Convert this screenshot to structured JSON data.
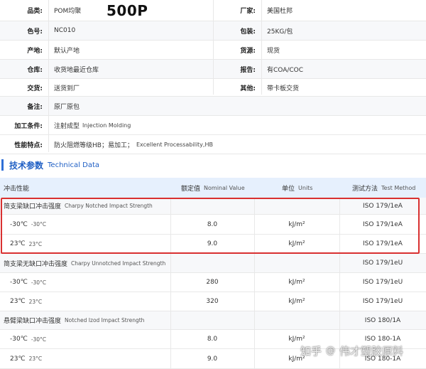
{
  "watermark_badge": "500P",
  "info": {
    "rows": [
      {
        "l1": "品类:",
        "v1": "POM均聚",
        "l2": "厂家:",
        "v2": "美国杜邦"
      },
      {
        "l1": "色号:",
        "v1": "NC010",
        "l2": "包装:",
        "v2": "25KG/包"
      },
      {
        "l1": "产地:",
        "v1": "默认产地",
        "l2": "货源:",
        "v2": "现货"
      },
      {
        "l1": "仓库:",
        "v1": "收货地最近仓库",
        "l2": "报告:",
        "v2": "有COA/COC"
      },
      {
        "l1": "交货:",
        "v1": "送货到厂",
        "l2": "其他:",
        "v2": "带卡板交货"
      },
      {
        "l1": "备注:",
        "v1": "原厂原包"
      },
      {
        "l1": "加工条件:",
        "v1": "注射成型",
        "v1_en": "Injection Molding"
      },
      {
        "l1": "性能特点:",
        "v1": "防火阻燃等级HB；易加工；",
        "v1_en": "Excellent Processability,HB"
      }
    ]
  },
  "section": {
    "title_cn": "技术参数",
    "title_en": "Technical Data"
  },
  "tech": {
    "header": {
      "col1": "冲击性能",
      "col2_cn": "额定值",
      "col2_en": "Nominal Value",
      "col3_cn": "单位",
      "col3_en": "Units",
      "col4_cn": "测试方法",
      "col4_en": "Test Method"
    },
    "rows": [
      {
        "type": "group",
        "cn": "简支梁缺口冲击强度",
        "en": "Charpy Notched Impact Strength",
        "method": "ISO 179/1eA"
      },
      {
        "type": "item",
        "cn": "-30℃",
        "en": "-30°C",
        "value": "8.0",
        "unit": "kJ/m²",
        "method": "ISO 179/1eA"
      },
      {
        "type": "item",
        "cn": "23℃",
        "en": "23°C",
        "value": "9.0",
        "unit": "kJ/m²",
        "method": "ISO 179/1eA"
      },
      {
        "type": "group",
        "cn": "简支梁无缺口冲击强度",
        "en": "Charpy Unnotched Impact Strength",
        "method": "ISO 179/1eU"
      },
      {
        "type": "item",
        "cn": "-30℃",
        "en": "-30°C",
        "value": "280",
        "unit": "kJ/m²",
        "method": "ISO 179/1eU"
      },
      {
        "type": "item",
        "cn": "23℃",
        "en": "23°C",
        "value": "320",
        "unit": "kJ/m²",
        "method": "ISO 179/1eU"
      },
      {
        "type": "group",
        "cn": "悬臂梁缺口冲击强度",
        "en": "Notched Izod Impact Strength",
        "method": "ISO 180/1A"
      },
      {
        "type": "item",
        "cn": "-30℃",
        "en": "-30°C",
        "value": "8.0",
        "unit": "kJ/m²",
        "method": "ISO 180-1A"
      },
      {
        "type": "item",
        "cn": "23℃",
        "en": "23°C",
        "value": "9.0",
        "unit": "kJ/m²",
        "method": "ISO 180-1A"
      }
    ]
  },
  "watermark": {
    "site": "知乎",
    "author": "伟才塑胶原料"
  }
}
